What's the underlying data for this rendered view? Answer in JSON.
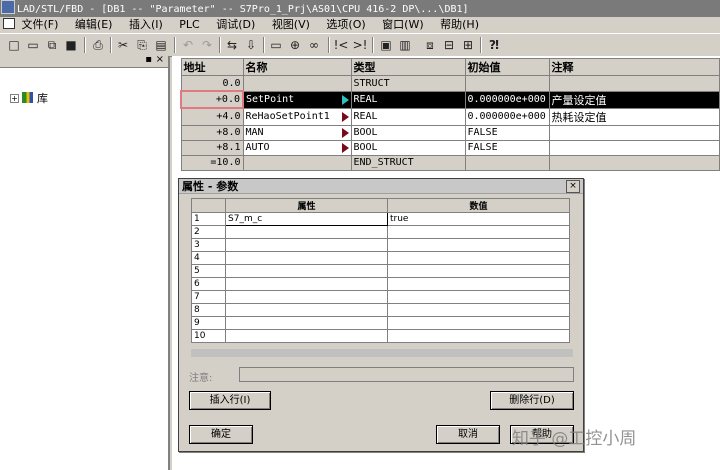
{
  "window": {
    "title": "LAD/STL/FBD  - [DB1 -- \"Parameter\" -- S7Pro_1_Prj\\AS01\\CPU 416-2 DP\\...\\DB1]"
  },
  "menu": [
    "文件(F)",
    "编辑(E)",
    "插入(I)",
    "PLC",
    "调试(D)",
    "视图(V)",
    "选项(O)",
    "窗口(W)",
    "帮助(H)"
  ],
  "tree": {
    "root_label": "库",
    "expand_symbol": "+"
  },
  "db_table": {
    "headers": {
      "address": "地址",
      "name": "名称",
      "type": "类型",
      "initial": "初始值",
      "comment": "注释"
    },
    "rows": [
      {
        "address": "0.0",
        "name": "",
        "type": "STRUCT",
        "initial": "",
        "comment": ""
      },
      {
        "address": "+0.0",
        "name": "SetPoint",
        "type": "REAL",
        "initial": "0.000000e+000",
        "comment": "产量设定值"
      },
      {
        "address": "+4.0",
        "name": "ReHaoSetPoint1",
        "type": "REAL",
        "initial": "0.000000e+000",
        "comment": "热耗设定值"
      },
      {
        "address": "+8.0",
        "name": "MAN",
        "type": "BOOL",
        "initial": "FALSE",
        "comment": ""
      },
      {
        "address": "+8.1",
        "name": "AUTO",
        "type": "BOOL",
        "initial": "FALSE",
        "comment": ""
      },
      {
        "address": "=10.0",
        "name": "",
        "type": "END_STRUCT",
        "initial": "",
        "comment": ""
      }
    ]
  },
  "dialog": {
    "title": "属性 - 参数",
    "close": "×",
    "col_attr": "属性",
    "col_value": "数值",
    "rows": [
      {
        "num": "1",
        "attr": "S7_m_c",
        "value": "true"
      },
      {
        "num": "2",
        "attr": "",
        "value": ""
      },
      {
        "num": "3",
        "attr": "",
        "value": ""
      },
      {
        "num": "4",
        "attr": "",
        "value": ""
      },
      {
        "num": "5",
        "attr": "",
        "value": ""
      },
      {
        "num": "6",
        "attr": "",
        "value": ""
      },
      {
        "num": "7",
        "attr": "",
        "value": ""
      },
      {
        "num": "8",
        "attr": "",
        "value": ""
      },
      {
        "num": "9",
        "attr": "",
        "value": ""
      },
      {
        "num": "10",
        "attr": "",
        "value": ""
      }
    ],
    "note_label": "注意:",
    "insert_row": "插入行(I)",
    "delete_row": "删除行(D)",
    "ok": "确定",
    "cancel": "取消",
    "help": "帮助"
  },
  "watermark": "知乎 @工控小周",
  "colors": {
    "selection_bg": "#000000",
    "grid_border": "#808080",
    "address_highlight": "#e07a80",
    "marker_red": "#7a0a1a",
    "marker_cyan": "#30c0c0"
  }
}
